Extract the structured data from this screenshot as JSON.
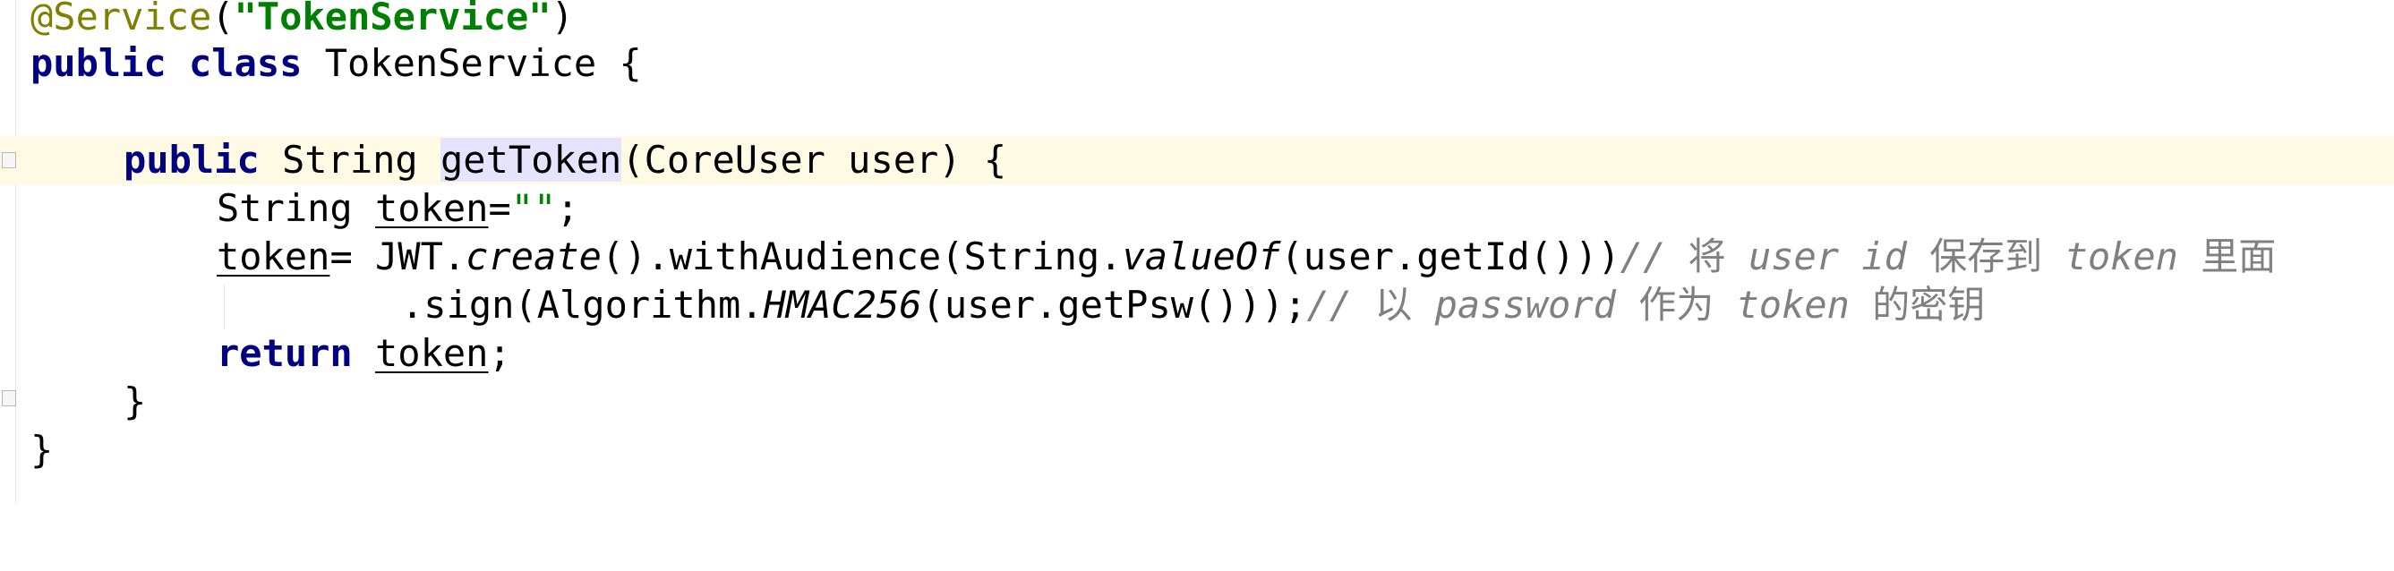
{
  "editor": {
    "lines": [
      {
        "annotation": "@Service",
        "paren_open": "(",
        "string": "\"TokenService\"",
        "paren_close": ")"
      },
      {
        "kw1": "public",
        "kw2": "class",
        "name": " TokenService {"
      },
      {},
      {
        "kw": "public",
        "ret_type": " String ",
        "method": "getToken",
        "params": "(CoreUser user) {"
      },
      {
        "type": "String ",
        "var": "token",
        "eq": "=",
        "str": "\"\"",
        "semi": ";"
      },
      {
        "var": "token",
        "rest1": "= JWT.",
        "create": "create",
        "rest2": "().withAudience(String.",
        "valueOf": "valueOf",
        "rest3": "(user.getId()))",
        "comment_a": "// ",
        "cjk1": "将",
        "comment_b": " user id ",
        "cjk2": "保存到",
        "comment_c": " token ",
        "cjk3": "里面"
      },
      {
        "rest1": ".sign(Algorithm.",
        "hmac": "HMAC256",
        "rest2": "(user.getPsw()));",
        "comment_a": "// ",
        "cjk1": "以",
        "comment_b": " password ",
        "cjk2": "作为",
        "comment_c": " token ",
        "cjk3": "的密钥"
      },
      {
        "kw": "return",
        "space": " ",
        "var": "token",
        "semi": ";"
      },
      {
        "brace": "}"
      },
      {
        "brace": "}"
      }
    ]
  },
  "colors": {
    "keyword": "#000080",
    "annotation": "#808000",
    "string": "#008000",
    "comment": "#808080",
    "current_line": "#fffae3",
    "highlight": "#e4e4ff"
  },
  "icons": [
    "fold-open-icon",
    "fold-close-icon"
  ]
}
